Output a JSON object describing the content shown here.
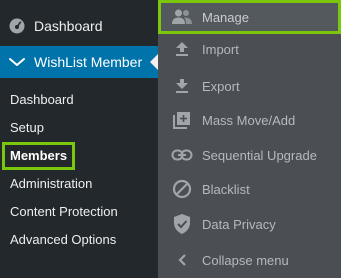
{
  "sidebar": {
    "dashboard_label": "Dashboard",
    "plugin_label": "WishList Member",
    "submenu": [
      {
        "label": "Dashboard"
      },
      {
        "label": "Setup"
      },
      {
        "label": "Members",
        "current": true
      },
      {
        "label": "Administration"
      },
      {
        "label": "Content Protection"
      },
      {
        "label": "Advanced Options"
      }
    ]
  },
  "flyout": {
    "items": [
      {
        "label": "Manage",
        "icon": "users-icon",
        "active": true
      },
      {
        "label": "Import",
        "icon": "upload-icon"
      },
      {
        "label": "Export",
        "icon": "download-icon"
      },
      {
        "label": "Mass Move/Add",
        "icon": "add-box-icon"
      },
      {
        "label": "Sequential Upgrade",
        "icon": "link-icon"
      },
      {
        "label": "Blacklist",
        "icon": "block-icon"
      },
      {
        "label": "Data Privacy",
        "icon": "shield-check-icon"
      },
      {
        "label": "Collapse menu",
        "icon": "chevron-left-icon"
      }
    ]
  },
  "colors": {
    "sidebar_bg": "#23282d",
    "active_plugin_bg": "#0073aa",
    "flyout_bg": "#4b4f54",
    "highlight_outline": "#7ac70c"
  }
}
